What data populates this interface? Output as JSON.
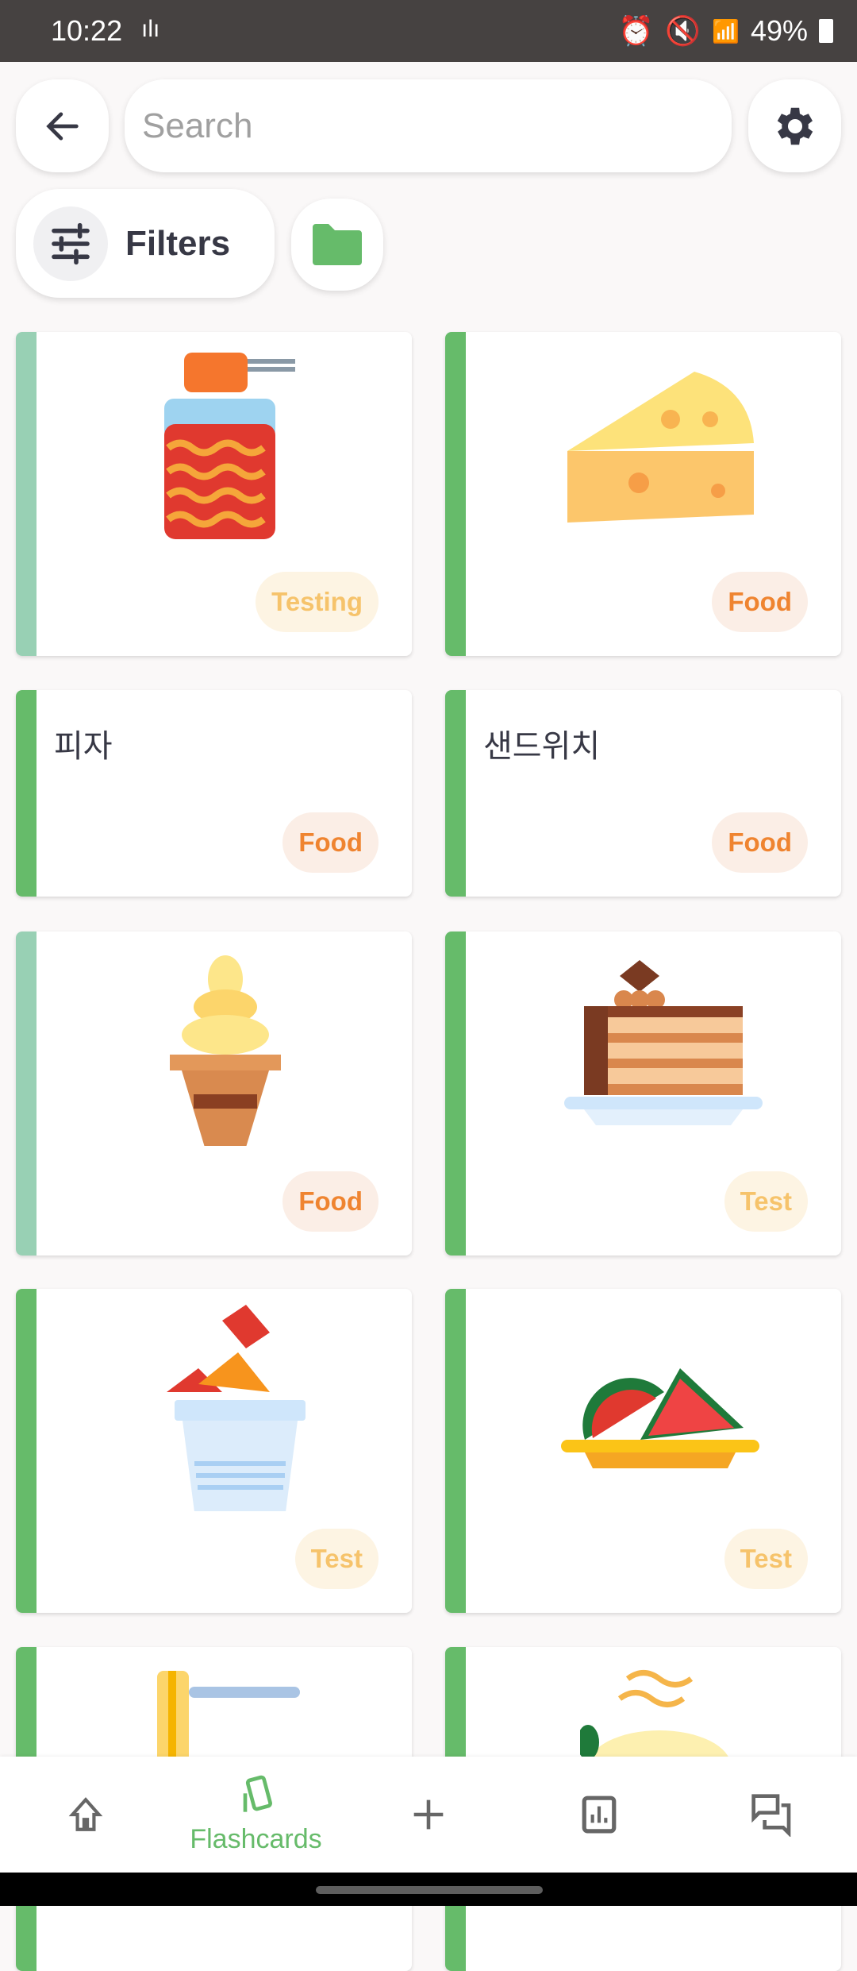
{
  "status_bar": {
    "time": "10:22",
    "battery": "49%"
  },
  "header": {
    "search_placeholder": "Search",
    "filters_label": "Filters"
  },
  "colors": {
    "accent": "#66bb6a",
    "accent_light": "#98d0b4",
    "food_badge": "#ef8430",
    "test_badge": "#f6c36b"
  },
  "cards": [
    {
      "image": "tteokbokki-cup",
      "badge": "Testing"
    },
    {
      "image": "cheese",
      "badge": "Food"
    },
    {
      "title": "피자",
      "badge": "Food"
    },
    {
      "title": "샌드위치",
      "badge": "Food"
    },
    {
      "image": "ice-cream-cone",
      "badge": "Food"
    },
    {
      "image": "layer-cake",
      "badge": "Test"
    },
    {
      "image": "fried-snack-cup",
      "badge": "Test"
    },
    {
      "image": "watermelon-plate",
      "badge": "Test"
    },
    {
      "image": "noodles-fork"
    },
    {
      "image": "rice-bowl"
    }
  ],
  "bottom_nav": {
    "active_label": "Flashcards"
  }
}
